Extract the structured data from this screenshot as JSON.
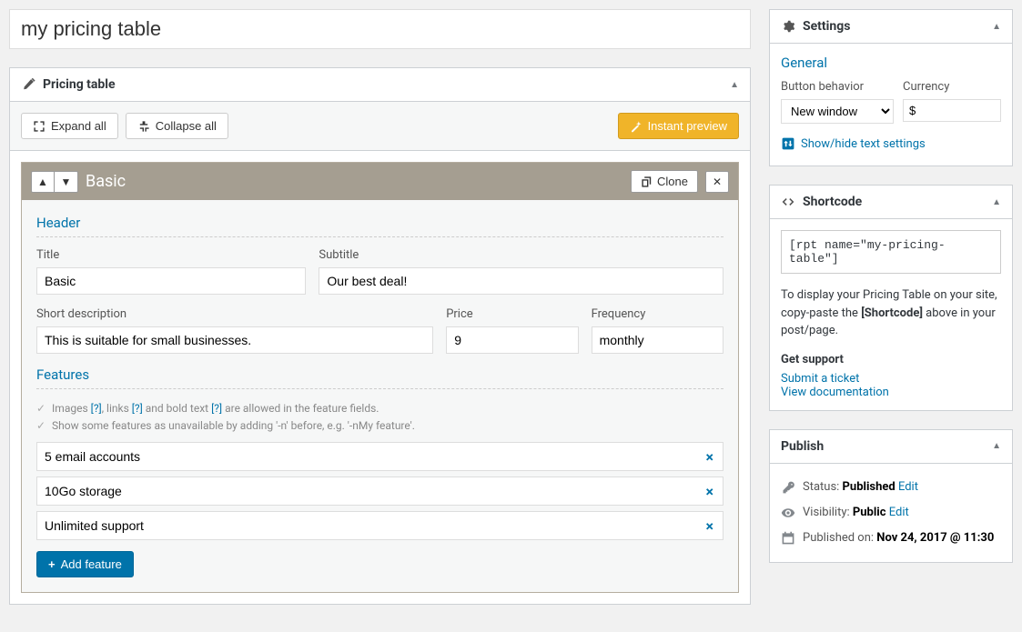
{
  "post": {
    "title": "my pricing table"
  },
  "metabox": {
    "title": "Pricing table"
  },
  "toolbar": {
    "expand_all": "Expand all",
    "collapse_all": "Collapse all",
    "instant_preview": "Instant preview"
  },
  "plan": {
    "name": "Basic",
    "clone": "Clone",
    "sections": {
      "header": "Header",
      "features": "Features"
    },
    "labels": {
      "title": "Title",
      "subtitle": "Subtitle",
      "short_desc": "Short description",
      "price": "Price",
      "frequency": "Frequency"
    },
    "values": {
      "title": "Basic",
      "subtitle": "Our best deal!",
      "short_desc": "This is suitable for small businesses.",
      "price": "9",
      "frequency": "monthly"
    },
    "hints": {
      "line1_pre": "Images ",
      "q1": "[?]",
      "line1_mid": ", links ",
      "q2": "[?]",
      "line1_mid2": " and bold text ",
      "q3": "[?]",
      "line1_end": " are allowed in the feature fields.",
      "line2": "Show some features as unavailable by adding '-n' before, e.g. '-nMy feature'."
    },
    "features": [
      "5 email accounts",
      "10Go storage",
      "Unlimited support"
    ],
    "add_feature": "Add feature"
  },
  "settings": {
    "title": "Settings",
    "general_section": "General",
    "button_behavior_label": "Button behavior",
    "button_behavior_value": "New window",
    "currency_label": "Currency",
    "currency_value": "$",
    "show_hide": "Show/hide text settings"
  },
  "shortcode": {
    "title": "Shortcode",
    "code": "[rpt name=\"my-pricing-table\"]",
    "desc_pre": "To display your Pricing Table on your site, copy-paste the ",
    "desc_bold": "[Shortcode]",
    "desc_post": " above in your post/page.",
    "support_head": "Get support",
    "submit_ticket": "Submit a ticket",
    "view_docs": "View documentation"
  },
  "publish": {
    "title": "Publish",
    "status_label": "Status: ",
    "status_value": "Published",
    "visibility_label": "Visibility: ",
    "visibility_value": "Public",
    "published_label": "Published on: ",
    "published_value": "Nov 24, 2017 @ 11:30",
    "edit": "Edit"
  }
}
